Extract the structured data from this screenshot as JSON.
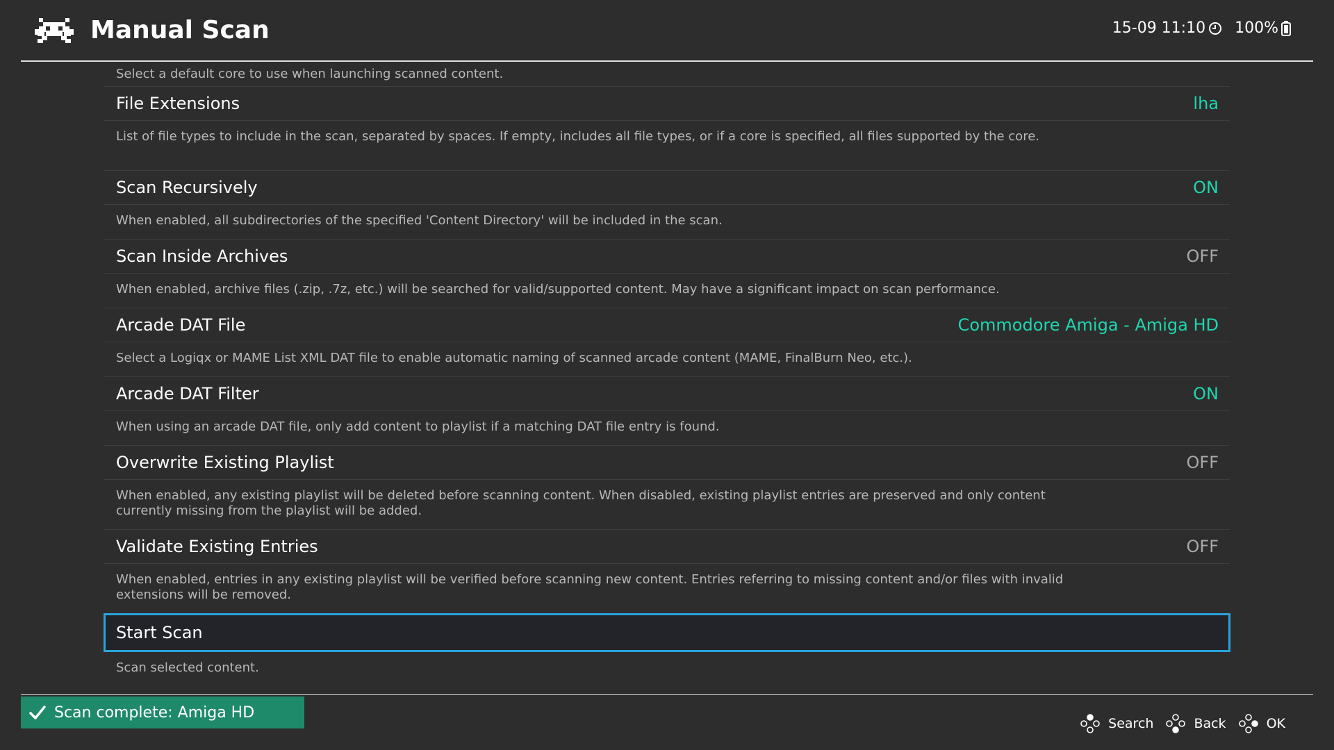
{
  "header": {
    "title": "Manual Scan",
    "datetime": "15-09 11:10",
    "battery": "100%",
    "logo_icon": "retroarch-invader-icon",
    "clock_icon": "clock-icon",
    "battery_icon": "battery-icon"
  },
  "menu": {
    "top_sublabel": "Select a default core to use when launching scanned content.",
    "items": [
      {
        "label": "File Extensions",
        "value": "lha",
        "sublabel": "List of file types to include in the scan, separated by spaces. If empty, includes all file types, or if a core is specified, all files supported by the core."
      },
      {
        "label": "Scan Recursively",
        "value": "ON",
        "sublabel": "When enabled, all subdirectories of the specified 'Content Directory' will be included in the scan."
      },
      {
        "label": "Scan Inside Archives",
        "value": "OFF",
        "sublabel": "When enabled, archive files (.zip, .7z, etc.) will be searched for valid/supported content. May have a significant impact on scan performance."
      },
      {
        "label": "Arcade DAT File",
        "value": "Commodore Amiga - Amiga HD",
        "sublabel": "Select a Logiqx or MAME List XML DAT file to enable automatic naming of scanned arcade content (MAME, FinalBurn Neo, etc.)."
      },
      {
        "label": "Arcade DAT Filter",
        "value": "ON",
        "sublabel": "When using an arcade DAT file, only add content to playlist if a matching DAT file entry is found."
      },
      {
        "label": "Overwrite Existing Playlist",
        "value": "OFF",
        "sublabel": "When enabled, any existing playlist will be deleted before scanning content. When disabled, existing playlist entries are preserved and only content currently missing from the playlist will be added."
      },
      {
        "label": "Validate Existing Entries",
        "value": "OFF",
        "sublabel": "When enabled, entries in any existing playlist will be verified before scanning new content. Entries referring to missing content and/or files with invalid extensions will be removed."
      },
      {
        "label": "Start Scan",
        "value": "",
        "sublabel": "Scan selected content."
      }
    ]
  },
  "notification": {
    "text": "Scan complete: Amiga HD",
    "icon": "check-icon"
  },
  "footer": {
    "hints": [
      {
        "label": "Search",
        "icon": "gamepad-button-icon"
      },
      {
        "label": "Back",
        "icon": "gamepad-button-icon"
      },
      {
        "label": "OK",
        "icon": "gamepad-button-icon"
      }
    ]
  },
  "colors": {
    "background": "#2d2d2d",
    "accent_on": "#1fd6b0",
    "selection_border": "#2aa4d8",
    "toast": "#1f8a6a"
  }
}
